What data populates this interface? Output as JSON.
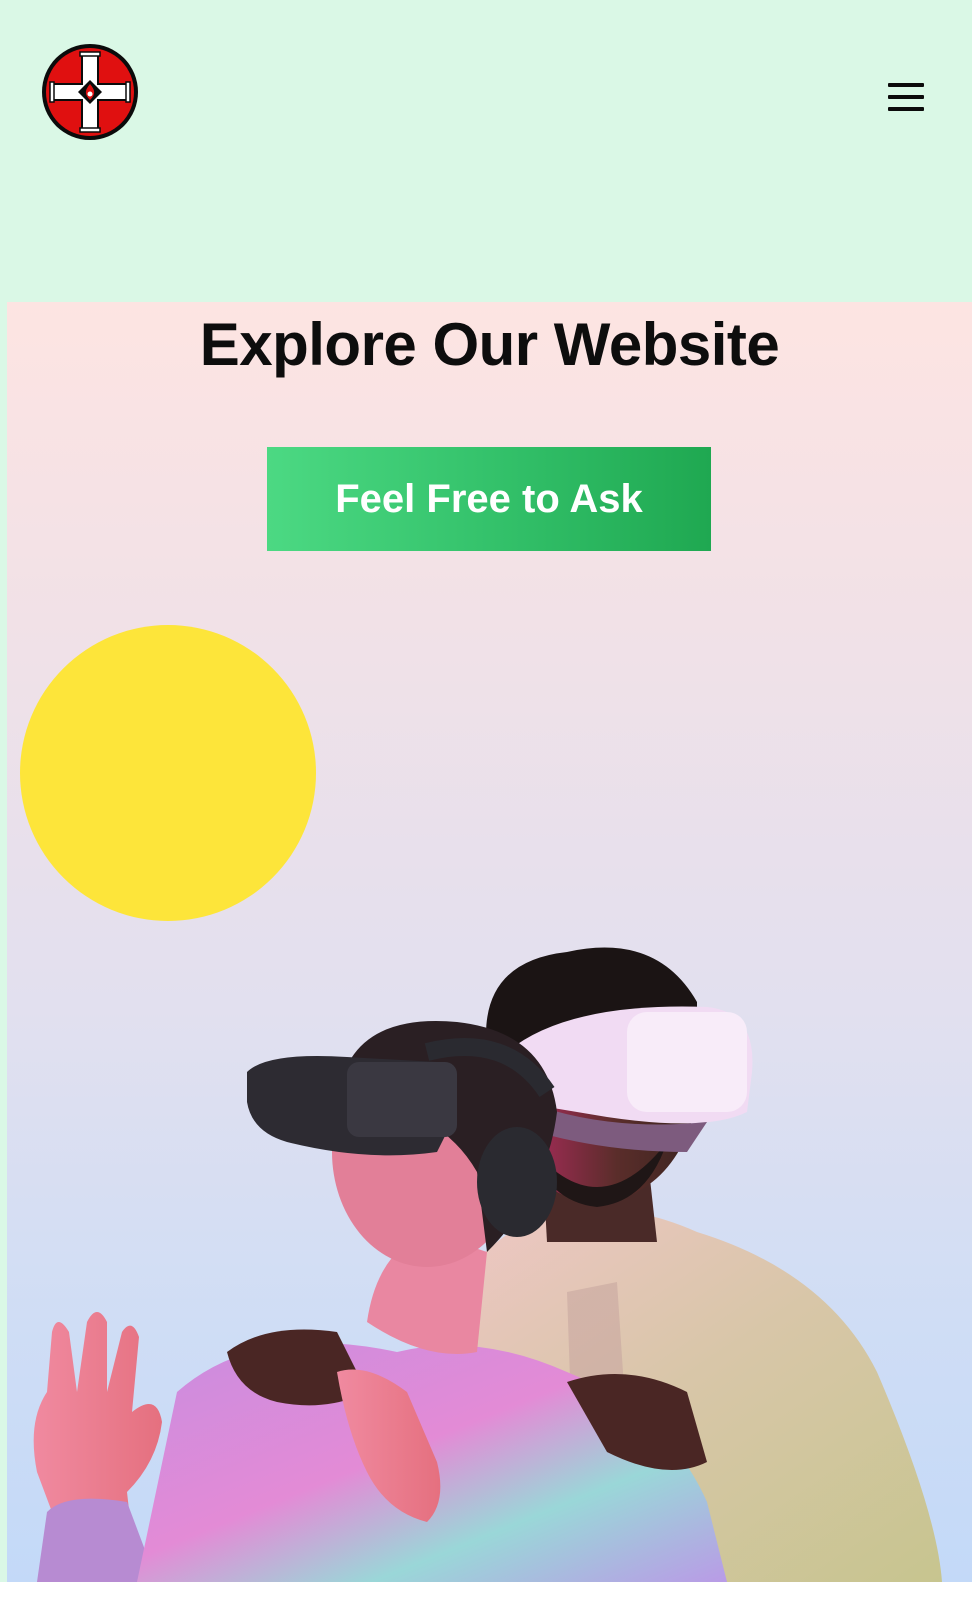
{
  "header": {
    "logo_icon": "red-cross-emblem-icon",
    "menu_icon": "hamburger-menu-icon"
  },
  "hero": {
    "title": "Explore Our Website",
    "cta_label": "Feel Free to Ask",
    "decor": "yellow-circle",
    "image": "vr-headset-couple-photo"
  },
  "colors": {
    "header_bg": "#daf8e6",
    "hero_top": "#fde4e2",
    "hero_bottom": "#c3d9f8",
    "cta_start": "#4cd983",
    "cta_end": "#1fa851",
    "sun": "#fde53a",
    "logo_red": "#e01010"
  }
}
